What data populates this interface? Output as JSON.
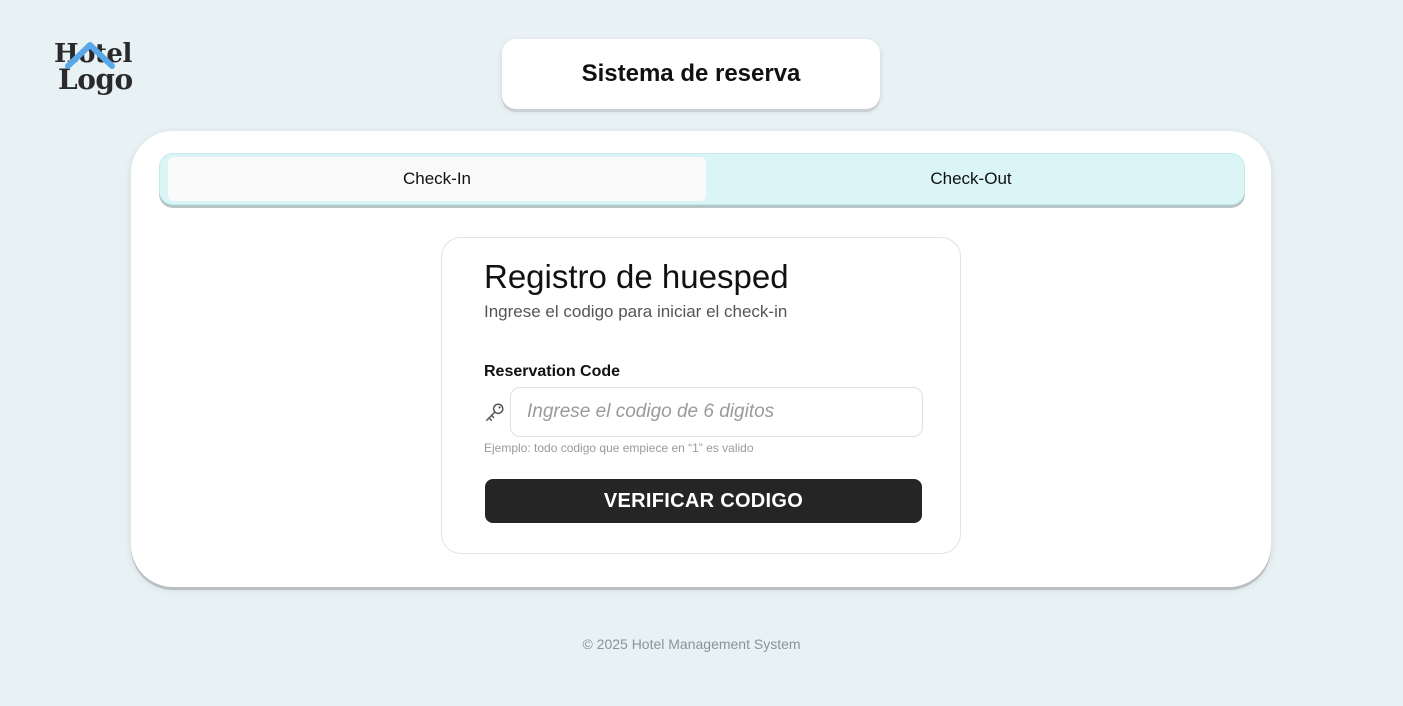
{
  "logo": {
    "line1": "Hotel",
    "line2": "Logo",
    "roof_color": "#5aa8e8"
  },
  "header": {
    "title": "Sistema de reserva"
  },
  "tabs": [
    {
      "label": "Check-In",
      "active": true
    },
    {
      "label": "Check-Out",
      "active": false
    }
  ],
  "form": {
    "title": "Registro de huesped",
    "subtitle": "Ingrese el codigo para iniciar el check-in",
    "field_label": "Reservation Code",
    "input_value": "",
    "input_placeholder": "Ingrese el codigo de 6 digitos",
    "input_icon": "key-icon",
    "hint": "Ejemplo: todo codigo que empiece en “1” es valido",
    "submit_label": "VERIFICAR CODIGO"
  },
  "footer": {
    "text": "© 2025 Hotel Management System"
  },
  "colors": {
    "page_bg": "#e8f1f4",
    "tab_bar_bg": "#dbf5f6",
    "button_bg": "#252525"
  }
}
